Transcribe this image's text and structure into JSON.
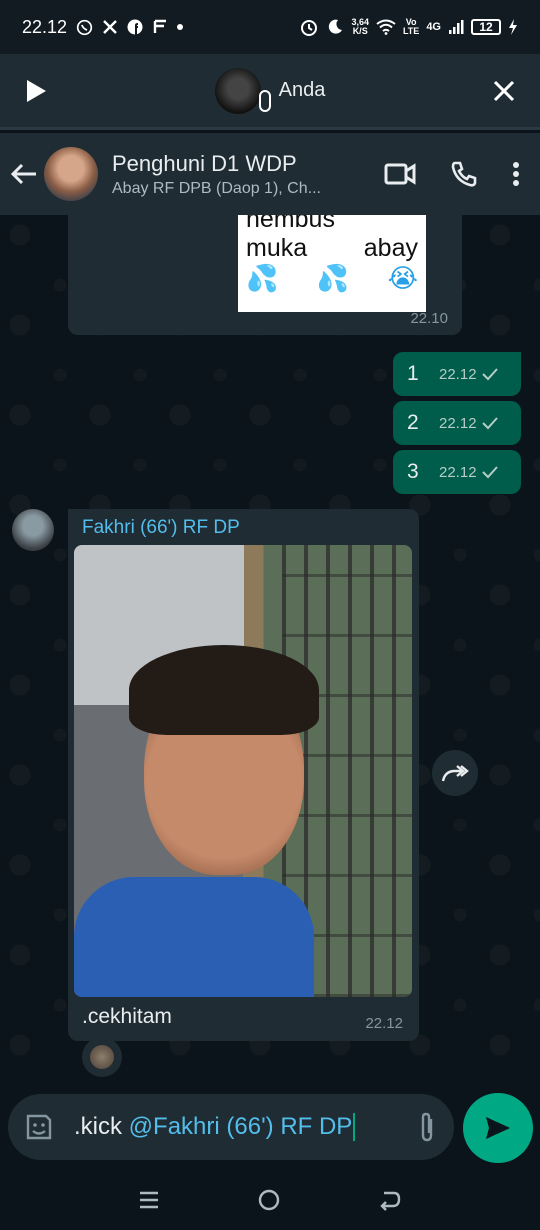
{
  "status_bar": {
    "time": "22.12",
    "speed_value": "3,64",
    "speed_unit": "K/S",
    "net_top": "Vo",
    "net_bottom": "LTE",
    "signal_label": "4G",
    "battery": "12"
  },
  "audio_bar": {
    "name": "Anda"
  },
  "chat_header": {
    "title": "Penghuni D1 WDP",
    "subtitle": "Abay RF DPB (Daop 1), Ch..."
  },
  "messages": {
    "sticker": {
      "line1": "nembus",
      "line2_a": "muka",
      "line2_b": "abay",
      "time": "22.10"
    },
    "outgoing": [
      {
        "text": "1",
        "time": "22.12"
      },
      {
        "text": "2",
        "time": "22.12"
      },
      {
        "text": "3",
        "time": "22.12"
      }
    ],
    "incoming_photo": {
      "sender": "Fakhri (66') RF DP",
      "caption": ".cekhitam",
      "time": "22.12"
    }
  },
  "input": {
    "prefix": ".kick ",
    "mention": "@Fakhri (66') RF DP"
  },
  "colors": {
    "outgoing_bubble": "#005c4b",
    "incoming_bubble": "#202c33",
    "accent": "#00a884",
    "sender_name": "#53bdeb"
  },
  "icons": {
    "play": "play-icon",
    "close": "close-icon",
    "back": "back-arrow-icon",
    "video": "video-call-icon",
    "call": "phone-icon",
    "menu": "more-vert-icon",
    "forward": "forward-icon",
    "sticker": "sticker-icon",
    "attach": "paperclip-icon",
    "send": "send-icon"
  }
}
